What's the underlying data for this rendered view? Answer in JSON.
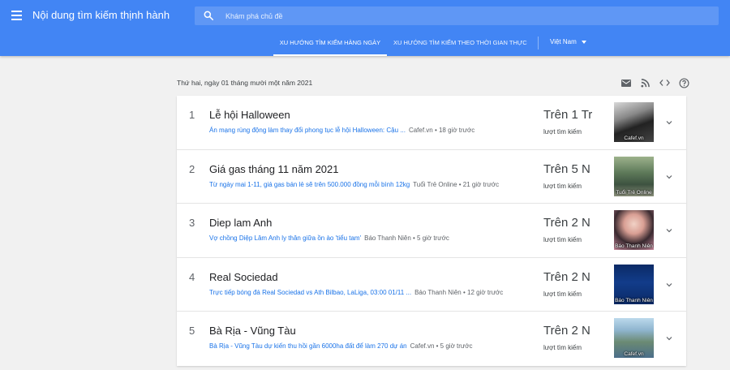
{
  "header": {
    "title": "Nội dung tìm kiếm thịnh hành",
    "search_placeholder": "Khám phá chủ đề",
    "tabs": [
      {
        "label": "XU HƯỚNG TÌM KIẾM HÀNG NGÀY",
        "active": true
      },
      {
        "label": "XU HƯỚNG TÌM KIẾM THEO THỜI GIAN THỰC",
        "active": false
      }
    ],
    "geo": "Việt Nam"
  },
  "date": "Thứ hai, ngày 01 tháng mười một năm 2021",
  "tools": [
    "email-icon",
    "rss-icon",
    "embed-code-icon",
    "help-icon"
  ],
  "trends": [
    {
      "rank": "1",
      "title": "Lễ hội Halloween",
      "article": "Án mạng rùng động làm thay đổi phong tục lễ hội Halloween: Cậu ...",
      "meta": "Cafef.vn • 18 giờ trước",
      "count": "Trên 1 Tr",
      "count_label": "lượt tìm kiếm",
      "thumb_source": "Cafef.vn"
    },
    {
      "rank": "2",
      "title": "Giá gas tháng 11 năm 2021",
      "article": "Từ ngày mai 1-11, giá gas bán lẻ sẽ trên 500.000 đồng mỗi bình 12kg",
      "meta": "Tuổi Trẻ Online • 21 giờ trước",
      "count": "Trên 5 N",
      "count_label": "lượt tìm kiếm",
      "thumb_source": "Tuổi Trẻ Online"
    },
    {
      "rank": "3",
      "title": "Diep lam Anh",
      "article": "Vợ chồng Diệp Lâm Anh ly thân giữa ồn ào 'tiểu tam'",
      "meta": "Báo Thanh Niên • 5 giờ trước",
      "count": "Trên 2 N",
      "count_label": "lượt tìm kiếm",
      "thumb_source": "Báo Thanh Niên"
    },
    {
      "rank": "4",
      "title": "Real Sociedad",
      "article": "Trực tiếp bóng đá Real Sociedad vs Ath Bilbao, LaLiga, 03:00 01/11 ...",
      "meta": "Báo Thanh Niên • 12 giờ trước",
      "count": "Trên 2 N",
      "count_label": "lượt tìm kiếm",
      "thumb_source": "Báo Thanh Niên"
    },
    {
      "rank": "5",
      "title": "Bà Rịa - Vũng Tàu",
      "article": "Bà Rịa - Vũng Tàu dự kiến thu hồi gần 6000ha đất để làm 270 dự án",
      "meta": "Cafef.vn • 5 giờ trước",
      "count": "Trên 2 N",
      "count_label": "lượt tìm kiếm",
      "thumb_source": "Cafef.vn"
    }
  ],
  "colors": {
    "appbar": "#4285f4",
    "link": "#1a73e8",
    "background": "#f1f1f1"
  }
}
